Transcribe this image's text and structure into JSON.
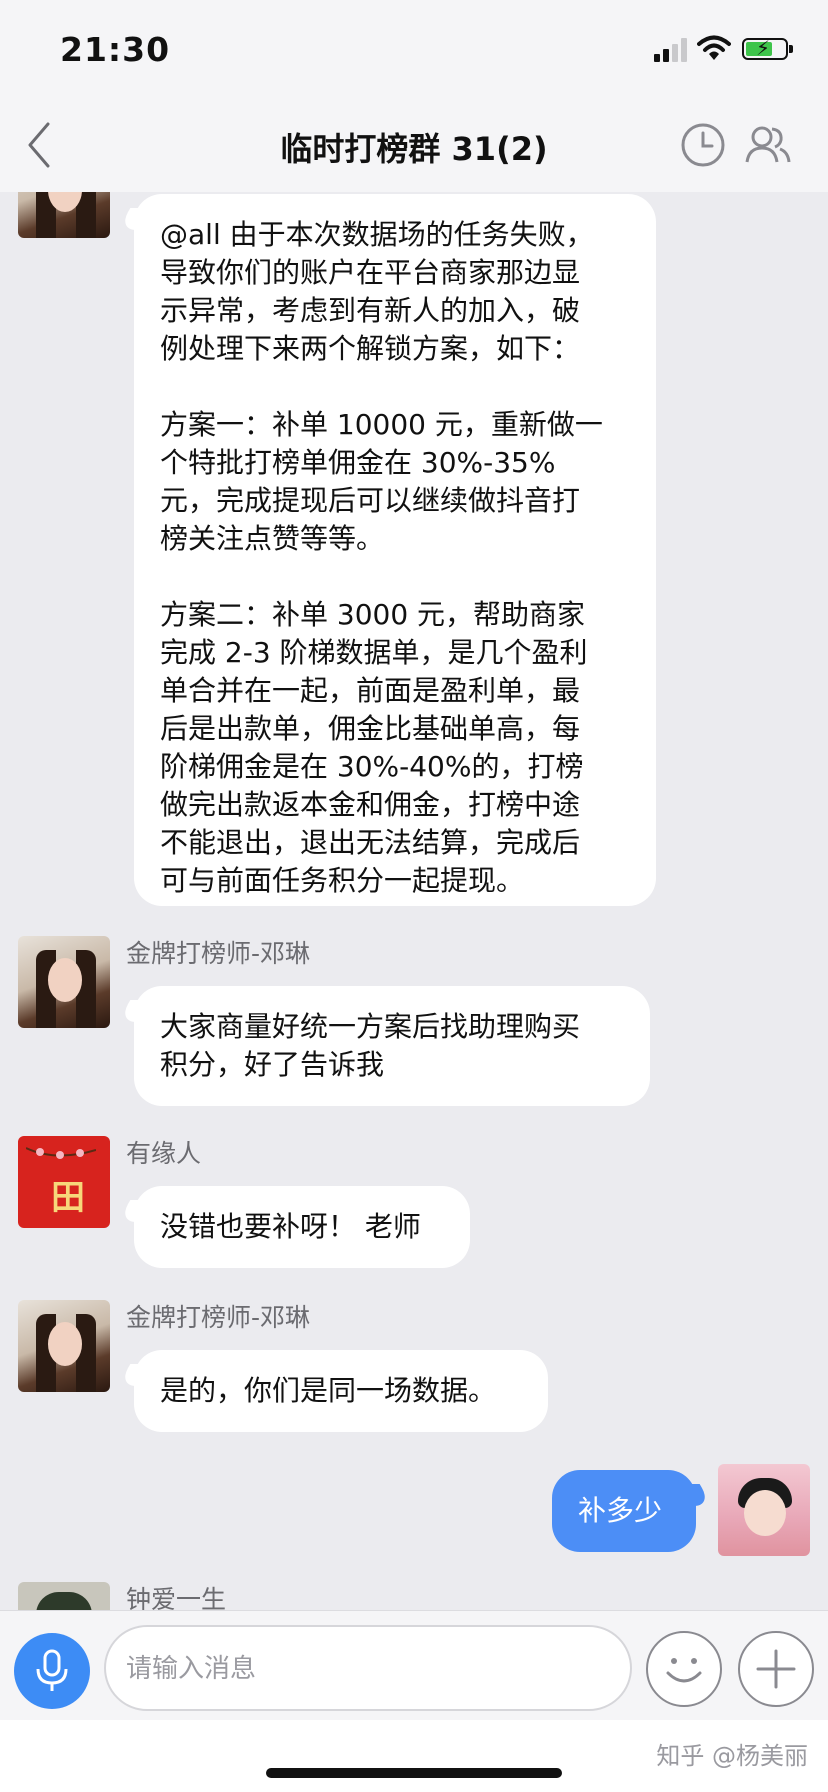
{
  "status": {
    "time": "21:30"
  },
  "header": {
    "title": "临时打榜群 31(2)"
  },
  "messages": {
    "m1": {
      "text": "@all 由于本次数据场的任务失败，\n导致你们的账户在平台商家那边显\n示异常，考虑到有新人的加入，破\n例处理下来两个解锁方案，如下：\n\n方案一：补单 10000 元，重新做一\n个特批打榜单佣金在 30%-35%\n元，完成提现后可以继续做抖音打\n榜关注点赞等等。\n\n方案二：补单 3000 元，帮助商家\n完成 2-3 阶梯数据单，是几个盈利\n单合并在一起，前面是盈利单，最\n后是出款单，佣金比基础单高，每\n阶梯佣金是在 30%-40%的，打榜\n做完出款返本金和佣金，打榜中途\n不能退出，退出无法结算，完成后\n可与前面任务积分一起提现。"
    },
    "m2": {
      "sender": "金牌打榜师-邓琳",
      "text": "大家商量好统一方案后找助理购买\n积分，好了告诉我"
    },
    "m3": {
      "sender": "有缘人",
      "text": "没错也要补呀！ 老师"
    },
    "m4": {
      "sender": "金牌打榜师-邓琳",
      "text": "是的，你们是同一场数据。"
    },
    "m5": {
      "text": "补多少"
    },
    "m6": {
      "sender": "钟爱一生"
    }
  },
  "input": {
    "placeholder": "请输入消息"
  },
  "watermark": "知乎 @杨美丽",
  "colors": {
    "accent": "#4c8ef6",
    "background": "#ebebef"
  }
}
